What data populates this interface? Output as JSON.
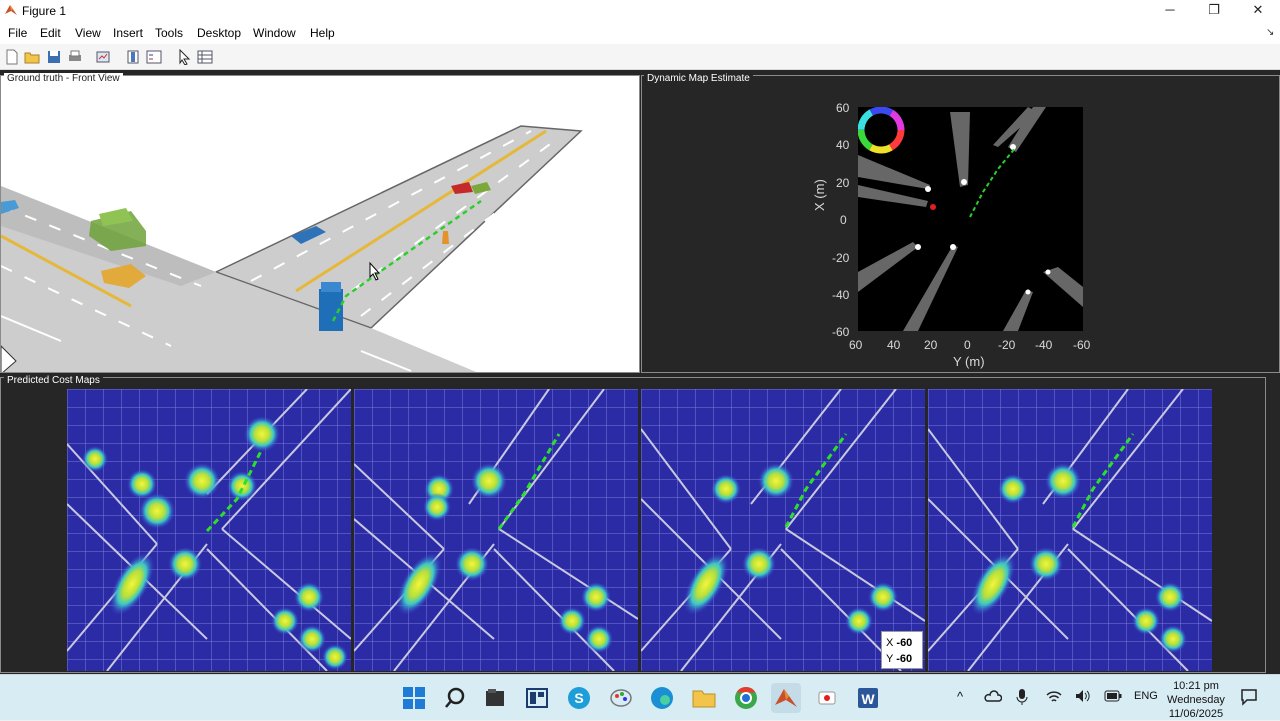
{
  "window": {
    "title": "Figure 1",
    "controls": [
      "minimize",
      "restore",
      "close"
    ]
  },
  "menu": [
    "File",
    "Edit",
    "View",
    "Insert",
    "Tools",
    "Desktop",
    "Window",
    "Help"
  ],
  "toolbar": {
    "icons": [
      "new-figure-icon",
      "open-file-icon",
      "save-icon",
      "print-icon",
      "link-plot-icon",
      "colorbar-icon",
      "legend-icon",
      "pointer-icon",
      "property-inspector-icon"
    ]
  },
  "panels": {
    "ground_truth": {
      "title": "Ground truth - Front View"
    },
    "dynamic_map": {
      "title": "Dynamic Map Estimate",
      "x_ticks": [
        "60",
        "40",
        "20",
        "0",
        "-20",
        "-40",
        "-60"
      ],
      "y_ticks": [
        "60",
        "40",
        "20",
        "0",
        "-20",
        "-40",
        "-60"
      ],
      "xlabel": "Y (m)",
      "ylabel": "X (m)"
    },
    "predicted": {
      "title": "Predicted Cost Maps",
      "datatip": {
        "x_label": "X",
        "x_value": "-60",
        "y_label": "Y",
        "y_value": "-60"
      }
    }
  },
  "taskbar": {
    "apps": [
      "windows-start-icon",
      "search-icon",
      "file-explorer-dark-icon",
      "widgets-icon",
      "skype-icon",
      "paint-icon",
      "edge-icon",
      "folder-icon",
      "chrome-icon",
      "matlab-icon",
      "recorder-icon",
      "word-icon"
    ],
    "tray": {
      "language": "ENG"
    },
    "clock": {
      "time": "10:21 pm",
      "day": "Wednesday",
      "date": "11/06/2025"
    }
  }
}
